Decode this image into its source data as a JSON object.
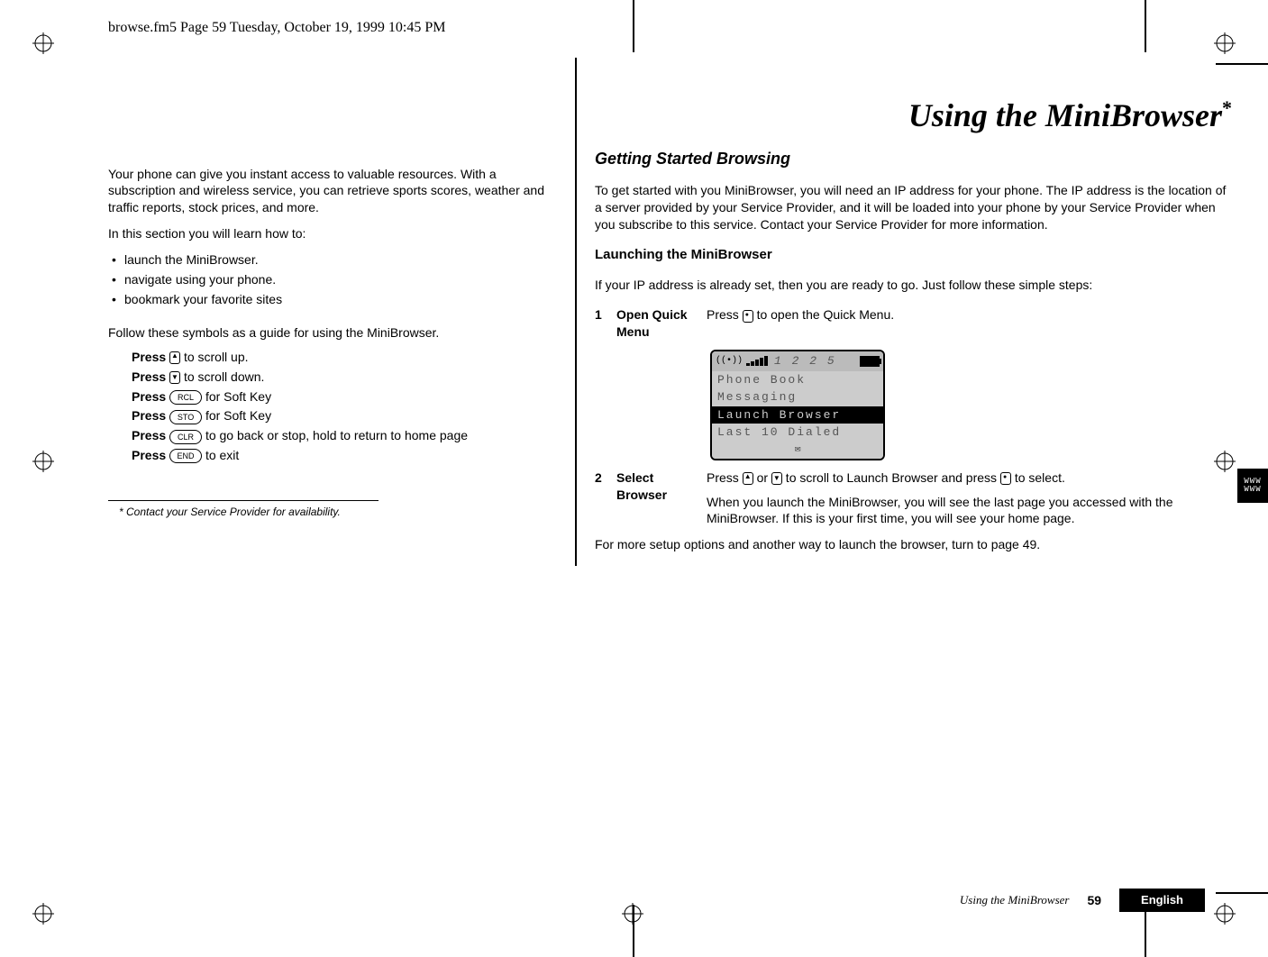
{
  "header": {
    "running": "browse.fm5  Page 59  Tuesday, October 19, 1999  10:45 PM"
  },
  "left": {
    "intro1": "Your phone can give you instant access to valuable resources. With a subscription and wireless service, you can retrieve sports scores, weather and traffic reports, stock prices, and more.",
    "intro2": "In this section you will learn how to:",
    "bullets": [
      "launch the MiniBrowser.",
      "navigate using your phone.",
      "bookmark your favorite sites"
    ],
    "follow": "Follow these symbols as a guide for using the MiniBrowser.",
    "guide": [
      {
        "pre": "Press",
        "post": " to scroll up."
      },
      {
        "pre": "Press",
        "post": " to scroll down."
      },
      {
        "pre": "Press",
        "key": "RCL",
        "post": " for Soft Key"
      },
      {
        "pre": "Press",
        "key": "STO",
        "post": " for Soft Key"
      },
      {
        "pre": "Press",
        "key": "CLR",
        "post": " to go back or stop, hold to return to home page"
      },
      {
        "pre": "Press",
        "key": "END",
        "post": " to exit"
      }
    ],
    "footnote": "*  Contact your Service Provider for availability."
  },
  "right": {
    "title": "Using the MiniBrowser",
    "titlestar": "*",
    "sec1": "Getting Started Browsing",
    "p1": "To get started with you MiniBrowser, you will need an IP address for your phone. The IP address is the location of a server provided by your Service Provider, and it will be loaded into your phone by your Service Provider when you subscribe to this service. Contact your Service Provider for more information.",
    "sub1": "Launching the MiniBrowser",
    "p2": "If your IP address is already set, then you are ready to go. Just follow these simple steps:",
    "step1": {
      "num": "1",
      "label": "Open Quick Menu",
      "desc_pre": "Press ",
      "desc_post": " to open the Quick Menu."
    },
    "screen": {
      "clock": "1 2 2 5",
      "rows": [
        "Phone Book",
        "Messaging",
        "Launch Browser",
        "Last 10 Dialed"
      ],
      "soft": "✉"
    },
    "step2": {
      "num": "2",
      "label": "Select Browser",
      "d1_pre": "Press ",
      "d1_mid": " or ",
      "d1_mid2": " to scroll to Launch Browser and press ",
      "d1_post": " to select.",
      "d2": "When you launch the MiniBrowser, you will see the last page you accessed with the MiniBrowser. If this is your first time, you will see your home page."
    },
    "after": "For more setup options and another way to launch the browser, turn to page 49."
  },
  "footer": {
    "title": "Using the MiniBrowser",
    "page": "59",
    "lang": "English"
  },
  "sidetab": {
    "l1": "WWW",
    "l2": "WWW"
  }
}
